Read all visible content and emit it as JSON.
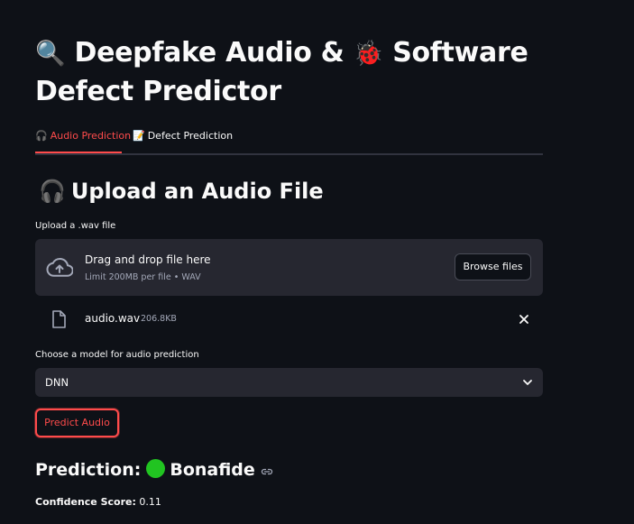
{
  "header": {
    "title_icon": "🔍",
    "title_part1": "Deepfake Audio &",
    "title_icon2": "🐞",
    "title_part2": "Software",
    "title_line2": "Defect Predictor"
  },
  "tabs": [
    {
      "icon": "🎧",
      "label": "Audio Prediction",
      "active": true
    },
    {
      "icon": "📝",
      "label": "Defect Prediction",
      "active": false
    }
  ],
  "section": {
    "icon": "🎧",
    "heading": "Upload an Audio File"
  },
  "uploader": {
    "label": "Upload a .wav file",
    "drag_text": "Drag and drop file here",
    "limit_text": "Limit 200MB per file • WAV",
    "browse_label": "Browse files",
    "icon": "cloud-upload-icon"
  },
  "uploaded_file": {
    "name": "audio.wav",
    "size": "206.8KB",
    "icon": "file-icon",
    "remove_icon": "close-icon"
  },
  "model_select": {
    "label": "Choose a model for audio prediction",
    "selected": "DNN",
    "icon": "chevron-down-icon"
  },
  "predict_button": {
    "label": "Predict Audio"
  },
  "result": {
    "prefix": "Prediction:",
    "value": "Bonafide",
    "dot_color": "#21c421",
    "confidence_label": "Confidence Score:",
    "confidence_value": "0.11"
  },
  "colors": {
    "background": "#0e1117",
    "surface": "#262730",
    "accent": "#ff4b4b",
    "text": "#fafafa",
    "muted": "#a3a8b8"
  }
}
